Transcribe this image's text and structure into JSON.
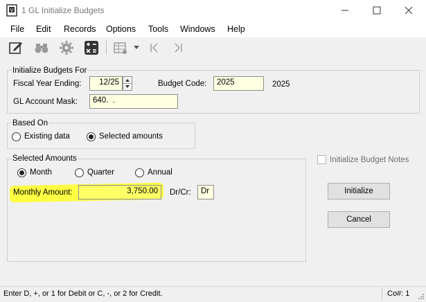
{
  "window": {
    "title": "1 GL Initialize Budgets"
  },
  "menu": [
    "File",
    "Edit",
    "Records",
    "Options",
    "Tools",
    "Windows",
    "Help"
  ],
  "toolbar": {
    "icons": [
      "edit-icon",
      "binoculars-icon",
      "gear-icon",
      "calculator-icon",
      "grid-icon",
      "dropdown-arrow-icon",
      "first-record-icon",
      "last-record-icon"
    ]
  },
  "init_group": {
    "title": "Initialize Budgets For",
    "fiscal_label": "Fiscal Year Ending:",
    "fiscal_value": "12/25",
    "budget_code_label": "Budget Code:",
    "budget_code_value": "2025",
    "budget_code_display": "2025",
    "mask_label": "GL Account Mask:",
    "mask_value": "640.  ."
  },
  "based_on": {
    "title": "Based On",
    "options": [
      "Existing data",
      "Selected amounts"
    ],
    "selected": "Selected amounts"
  },
  "selected_amounts": {
    "title": "Selected Amounts",
    "options": [
      "Month",
      "Quarter",
      "Annual"
    ],
    "selected": "Month",
    "amount_label": "Monthly Amount:",
    "amount_value": "3,750.00",
    "drcr_label": "Dr/Cr:",
    "drcr_value": "Dr"
  },
  "notes_checkbox": {
    "label": "Initialize Budget Notes",
    "checked": false
  },
  "buttons": {
    "initialize": "Initialize",
    "cancel": "Cancel"
  },
  "status": {
    "message": "Enter D, +, or 1 for Debit or C, -, or 2 for Credit.",
    "company": "Co#: 1"
  },
  "colors": {
    "field_bg": "#ffffe1",
    "highlight": "#ffff33"
  }
}
